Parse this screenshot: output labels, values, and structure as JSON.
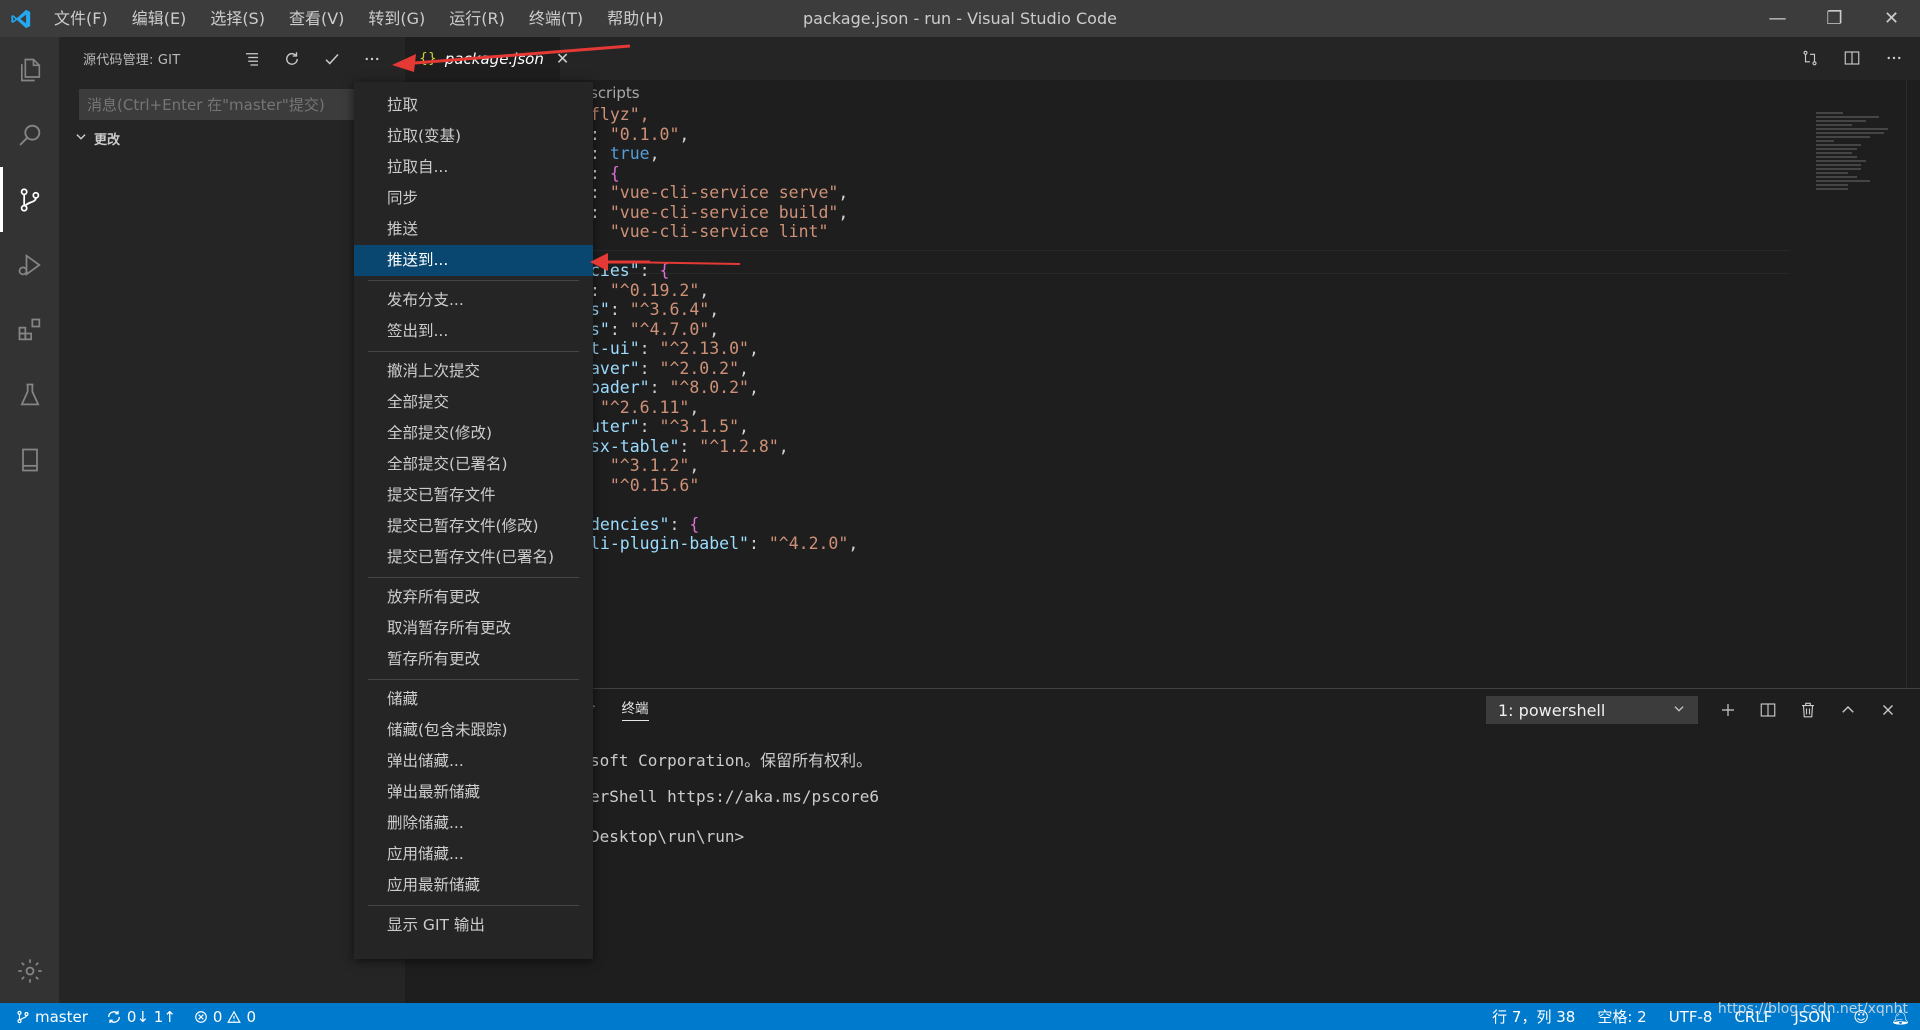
{
  "window": {
    "title": "package.json - run - Visual Studio Code",
    "minimize": "—",
    "maximize": "❐",
    "close": "✕"
  },
  "menubar": [
    "文件(F)",
    "编辑(E)",
    "选择(S)",
    "查看(V)",
    "转到(G)",
    "运行(R)",
    "终端(T)",
    "帮助(H)"
  ],
  "activitybar": {
    "items": [
      "explorer-icon",
      "search-icon",
      "source-control-icon",
      "run-debug-icon",
      "extensions-icon",
      "testing-icon",
      "book-icon"
    ],
    "bottom": "settings-gear-icon"
  },
  "sidebar": {
    "title": "源代码管理: GIT",
    "commit_placeholder": "消息(Ctrl+Enter 在\"master\"提交)",
    "changes_label": "更改"
  },
  "editor": {
    "tab_label": "package.json",
    "tab_icon": "{}",
    "breadcrumb": "scripts",
    "lines": [
      {
        "parts": [
          {
            "t": "flyz\",",
            "c": "c-str",
            "pre": "\""
          }
        ]
      },
      {
        "parts": [
          {
            "t": ": ",
            "c": ""
          },
          {
            "t": "\"0.1.0\"",
            "c": "c-str"
          },
          {
            "t": ",",
            "c": ""
          }
        ]
      },
      {
        "parts": [
          {
            "t": ": ",
            "c": ""
          },
          {
            "t": "true",
            "c": "c-bool"
          },
          {
            "t": ",",
            "c": ""
          }
        ]
      },
      {
        "parts": [
          {
            "t": ": ",
            "c": ""
          },
          {
            "t": "{",
            "c": "c-brace"
          }
        ]
      },
      {
        "parts": [
          {
            "t": ": ",
            "c": ""
          },
          {
            "t": "\"vue-cli-service serve\"",
            "c": "c-str"
          },
          {
            "t": ",",
            "c": ""
          }
        ]
      },
      {
        "parts": [
          {
            "t": ": ",
            "c": ""
          },
          {
            "t": "\"vue-cli-service build\"",
            "c": "c-str"
          },
          {
            "t": ",",
            "c": ""
          }
        ]
      },
      {
        "parts": [
          {
            "t": "  ",
            "c": ""
          },
          {
            "t": "\"vue-cli-service lint\"",
            "c": "c-str"
          }
        ]
      },
      {
        "parts": [
          {
            "t": "",
            "c": ""
          }
        ]
      },
      {
        "parts": [
          {
            "t": "cies\"",
            "c": "c-key"
          },
          {
            "t": ": ",
            "c": ""
          },
          {
            "t": "{",
            "c": "c-brace"
          }
        ]
      },
      {
        "parts": [
          {
            "t": ": ",
            "c": ""
          },
          {
            "t": "\"^0.19.2\"",
            "c": "c-str"
          },
          {
            "t": ",",
            "c": ""
          }
        ]
      },
      {
        "parts": [
          {
            "t": "s\"",
            "c": "c-key"
          },
          {
            "t": ": ",
            "c": ""
          },
          {
            "t": "\"^3.6.4\"",
            "c": "c-str"
          },
          {
            "t": ",",
            "c": ""
          }
        ]
      },
      {
        "parts": [
          {
            "t": "s\"",
            "c": "c-key"
          },
          {
            "t": ": ",
            "c": ""
          },
          {
            "t": "\"^4.7.0\"",
            "c": "c-str"
          },
          {
            "t": ",",
            "c": ""
          }
        ]
      },
      {
        "parts": [
          {
            "t": "t-ui\"",
            "c": "c-key"
          },
          {
            "t": ": ",
            "c": ""
          },
          {
            "t": "\"^2.13.0\"",
            "c": "c-str"
          },
          {
            "t": ",",
            "c": ""
          }
        ]
      },
      {
        "parts": [
          {
            "t": "aver\"",
            "c": "c-key"
          },
          {
            "t": ": ",
            "c": ""
          },
          {
            "t": "\"^2.0.2\"",
            "c": "c-str"
          },
          {
            "t": ",",
            "c": ""
          }
        ]
      },
      {
        "parts": [
          {
            "t": "oader\"",
            "c": "c-key"
          },
          {
            "t": ": ",
            "c": ""
          },
          {
            "t": "\"^8.0.2\"",
            "c": "c-str"
          },
          {
            "t": ",",
            "c": ""
          }
        ]
      },
      {
        "parts": [
          {
            "t": " ",
            "c": ""
          },
          {
            "t": "\"^2.6.11\"",
            "c": "c-str"
          },
          {
            "t": ",",
            "c": ""
          }
        ]
      },
      {
        "parts": [
          {
            "t": "uter\"",
            "c": "c-key"
          },
          {
            "t": ": ",
            "c": ""
          },
          {
            "t": "\"^3.1.5\"",
            "c": "c-str"
          },
          {
            "t": ",",
            "c": ""
          }
        ]
      },
      {
        "parts": [
          {
            "t": "sx-table\"",
            "c": "c-key"
          },
          {
            "t": ": ",
            "c": ""
          },
          {
            "t": "\"^1.2.8\"",
            "c": "c-str"
          },
          {
            "t": ",",
            "c": ""
          }
        ]
      },
      {
        "parts": [
          {
            "t": "  ",
            "c": ""
          },
          {
            "t": "\"^3.1.2\"",
            "c": "c-str"
          },
          {
            "t": ",",
            "c": ""
          }
        ]
      },
      {
        "parts": [
          {
            "t": "  ",
            "c": ""
          },
          {
            "t": "\"^0.15.6\"",
            "c": "c-str"
          }
        ]
      },
      {
        "parts": [
          {
            "t": "",
            "c": ""
          }
        ]
      },
      {
        "parts": [
          {
            "t": "dencies\"",
            "c": "c-key"
          },
          {
            "t": ": ",
            "c": ""
          },
          {
            "t": "{",
            "c": "c-brace"
          }
        ]
      },
      {
        "parts": [
          {
            "t": "li-plugin-babel\"",
            "c": "c-key"
          },
          {
            "t": ": ",
            "c": ""
          },
          {
            "t": "\"^4.2.0\"",
            "c": "c-str"
          },
          {
            "t": ",",
            "c": ""
          }
        ]
      }
    ]
  },
  "panel": {
    "tabs": [
      "令",
      "终端"
    ],
    "terminal_select": "1: powershell",
    "terminal_lines": [
      "soft Corporation。保留所有权利。",
      "",
      "erShell https://aka.ms/pscore6",
      "",
      "Desktop\\run\\run>"
    ]
  },
  "context_menu": {
    "groups": [
      [
        "拉取",
        "拉取(变基)",
        "拉取自...",
        "同步",
        "推送",
        "推送到..."
      ],
      [
        "发布分支...",
        "签出到..."
      ],
      [
        "撤消上次提交",
        "全部提交",
        "全部提交(修改)",
        "全部提交(已署名)",
        "提交已暂存文件",
        "提交已暂存文件(修改)",
        "提交已暂存文件(已署名)"
      ],
      [
        "放弃所有更改",
        "取消暂存所有更改",
        "暂存所有更改"
      ],
      [
        "储藏",
        "储藏(包含未跟踪)",
        "弹出储藏...",
        "弹出最新储藏",
        "删除储藏...",
        "应用储藏...",
        "应用最新储藏"
      ],
      [
        "显示 GIT 输出"
      ]
    ],
    "selected": "推送到..."
  },
  "statusbar": {
    "branch": "master",
    "sync": "0↓ 1↑",
    "errors": "0",
    "warnings": "0",
    "position": "行 7，列 38",
    "spaces": "空格: 2",
    "encoding": "UTF-8",
    "eol": "CRLF",
    "language": "JSON",
    "watermark": "https://blog.csdn.net/xqnht"
  },
  "colors": {
    "accent": "#007acc",
    "menu_selected": "#094771",
    "annotation_arrow": "#e53935"
  }
}
